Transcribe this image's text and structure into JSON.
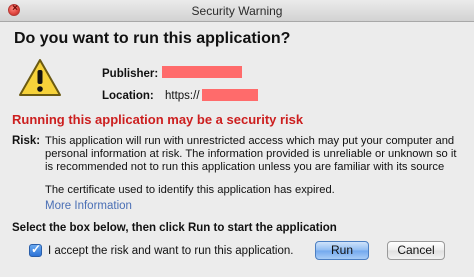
{
  "window": {
    "title": "Security Warning"
  },
  "dialog": {
    "headline": "Do you want to run this application?",
    "publisher_label": "Publisher:",
    "location_label": "Location:",
    "location_value": "https://",
    "risk_headline": "Running this application may be a security risk",
    "risk_label": "Risk:",
    "risk_lines": [
      "This application will run with unrestricted access which may put your computer and",
      "personal information at risk. The information provided is unreliable or unknown so it",
      "is recommended not to run this application unless you are familiar with its source"
    ],
    "certificate_text": "The certificate used to identify this application has expired.",
    "more_info_link": "More Information",
    "instruction": "Select the box below, then click Run to start the application",
    "checkbox_label": "I accept the risk and want to run this application.",
    "checkbox_checked": true,
    "run_button": "Run",
    "cancel_button": "Cancel"
  },
  "icons": {
    "close": "close-icon",
    "warning": "warning-icon",
    "checkmark": "checkmark-icon"
  },
  "colors": {
    "risk_headline": "#cc1f1f",
    "redaction": "#ff6b6b",
    "link": "#4a6fb5",
    "default_button": "#72a8ee"
  }
}
